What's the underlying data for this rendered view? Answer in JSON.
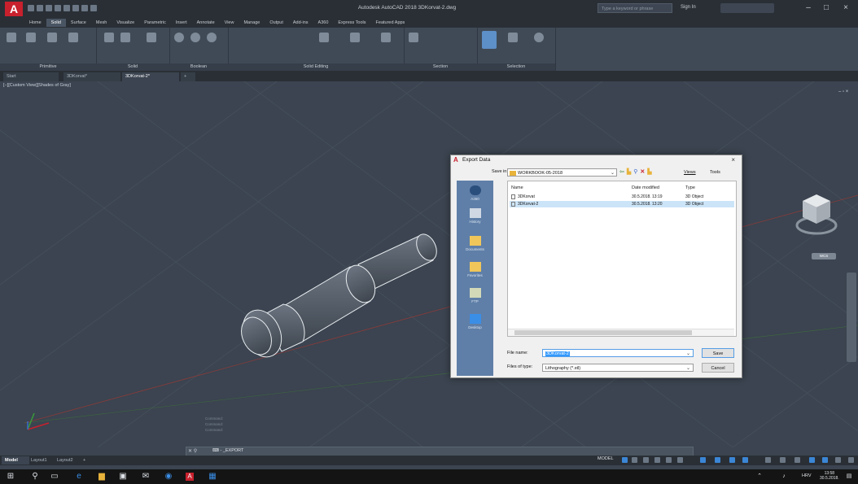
{
  "titlebar": {
    "app_logo": "A",
    "title": "Autodesk AutoCAD 2018   3DKorvat-2.dwg",
    "search_placeholder": "Type a keyword or phrase",
    "signin": "Sign In",
    "minimize": "–",
    "maximize": "□",
    "close": "×"
  },
  "ribbon_tabs": [
    "Home",
    "Solid",
    "Surface",
    "Mesh",
    "Visualize",
    "Parametric",
    "Insert",
    "Annotate",
    "View",
    "Manage",
    "Output",
    "Add-ins",
    "A360",
    "Express Tools",
    "Featured Apps"
  ],
  "ribbon_active_tab": "Solid",
  "ribbon_panels": {
    "primitive": "Primitive",
    "solid": "Solid",
    "boolean": "Boolean",
    "solid_editing": "Solid Editing",
    "section": "Section",
    "selection": "Selection"
  },
  "file_tabs": [
    "Start",
    "3DKorvat*",
    "3DKorvat-2*"
  ],
  "file_tab_active": "3DKorvat-2*",
  "file_tab_add": "+",
  "viewport": {
    "label": "[−][Custom View][Shades of Gray]",
    "controls": "– ▫ ×",
    "wcs": "WCS"
  },
  "command": {
    "history": [
      "Command:",
      "Command:",
      "Command:"
    ],
    "prompt": "⌨ - _EXPORT"
  },
  "layout_tabs": [
    "Model",
    "Layout1",
    "Layout2"
  ],
  "layout_add": "+",
  "status": {
    "model": "MODEL"
  },
  "taskbar": {
    "lang": "HRV",
    "time": "13:58",
    "date": "30.5.2018."
  },
  "dialog": {
    "title": "Export Data",
    "close": "×",
    "save_in_label": "Save in:",
    "save_in_value": "WORKBOOK-05-2018",
    "views": "Views",
    "tools": "Tools",
    "places": [
      "A360",
      "History",
      "Documents",
      "Favorites",
      "FTP",
      "Desktop"
    ],
    "columns": [
      "Name",
      "Date modified",
      "Type"
    ],
    "files": [
      {
        "name": "3DKorvat",
        "date": "30.5.2018. 13:19",
        "type": "3D Object"
      },
      {
        "name": "3DKorvat-2",
        "date": "30.5.2018. 13:20",
        "type": "3D Object"
      }
    ],
    "file_name_label": "File name:",
    "file_name_value": "3DKorvat-2",
    "file_type_label": "Files of type:",
    "file_type_value": "Lithography (*.stl)",
    "save_button": "Save",
    "cancel_button": "Cancel"
  },
  "colors": {
    "accent": "#c8202d",
    "viewport_bg": "#3b4450",
    "dialog_places": "#5f7fa8"
  }
}
